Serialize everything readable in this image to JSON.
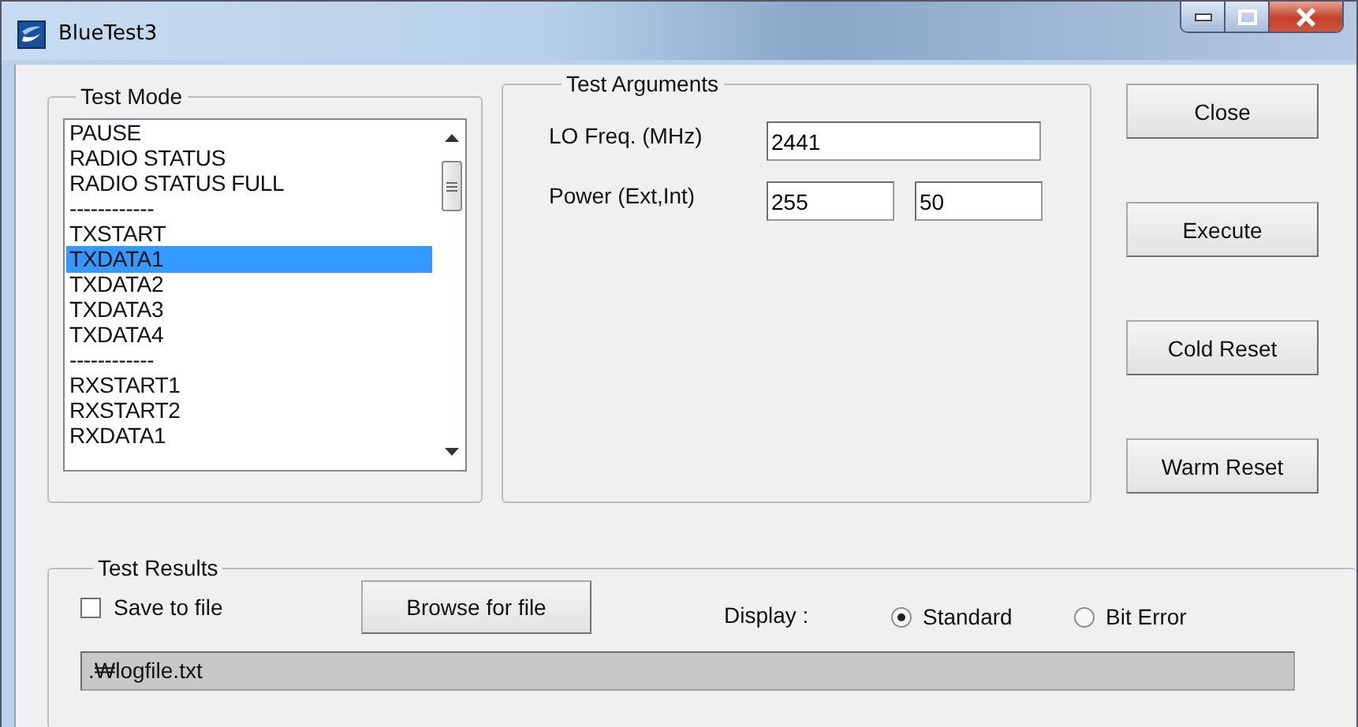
{
  "window": {
    "title": "BlueTest3"
  },
  "test_mode": {
    "title": "Test Mode",
    "items": [
      {
        "label": "PAUSE",
        "selected": false
      },
      {
        "label": "RADIO STATUS",
        "selected": false
      },
      {
        "label": "RADIO STATUS FULL",
        "selected": false
      },
      {
        "label": "------------",
        "selected": false
      },
      {
        "label": "TXSTART",
        "selected": false
      },
      {
        "label": "TXDATA1",
        "selected": true
      },
      {
        "label": "TXDATA2",
        "selected": false
      },
      {
        "label": "TXDATA3",
        "selected": false
      },
      {
        "label": "TXDATA4",
        "selected": false
      },
      {
        "label": "------------",
        "selected": false
      },
      {
        "label": "RXSTART1",
        "selected": false
      },
      {
        "label": "RXSTART2",
        "selected": false
      },
      {
        "label": "RXDATA1",
        "selected": false
      }
    ]
  },
  "test_arguments": {
    "title": "Test Arguments",
    "lo_freq": {
      "label": "LO Freq. (MHz)",
      "value": "2441"
    },
    "power": {
      "label": "Power (Ext,Int)",
      "ext": "255",
      "int": "50"
    }
  },
  "buttons": [
    "Close",
    "Execute",
    "Cold Reset",
    "Warm Reset"
  ],
  "test_results": {
    "title": "Test Results",
    "save_to_file": {
      "label": "Save to file",
      "checked": false
    },
    "browse_button": "Browse for file",
    "display_label": "Display :",
    "display_options": [
      {
        "label": "Standard",
        "selected": true
      },
      {
        "label": "Bit Error",
        "selected": false
      }
    ],
    "path": ".₩logfile.txt"
  }
}
